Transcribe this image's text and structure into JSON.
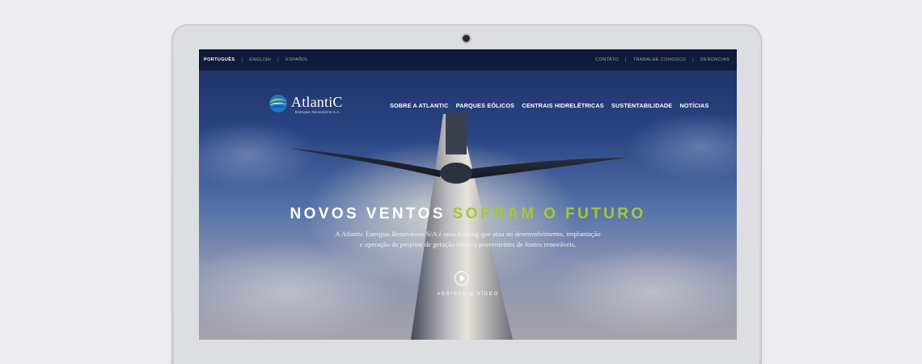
{
  "topbar": {
    "languages": [
      "PORTUGUÊS",
      "ENGLISH",
      "ESPAÑOL"
    ],
    "links": [
      "CONTATO",
      "TRABALHE CONOSCO",
      "DENÚNCIAS"
    ]
  },
  "logo": {
    "word": "AtlantiC",
    "subtitle": "Energias Renováveis S.A."
  },
  "nav": [
    "SOBRE A ATLANTIC",
    "PARQUES EÓLICOS",
    "CENTRAIS HIDRELÉTRICAS",
    "SUSTENTABILIDADE",
    "NOTÍCIAS"
  ],
  "hero": {
    "headline_white": "NOVOS VENTOS",
    "headline_accent": "SOPRAM O FUTURO",
    "description_line1": "A Atlantic Energias Renováveis S/A é uma holding que atua no desenvolvimento, implantação",
    "description_line2": "e operação de projetos de geração elétrica provenientes de fontes renováveis.",
    "video_label": "ASSISTA O VÍDEO"
  },
  "colors": {
    "accent": "#a6c92f",
    "sky_top": "#1d2f63"
  },
  "icons": [
    "camera-icon",
    "atlantic-logo-icon",
    "play-icon"
  ]
}
